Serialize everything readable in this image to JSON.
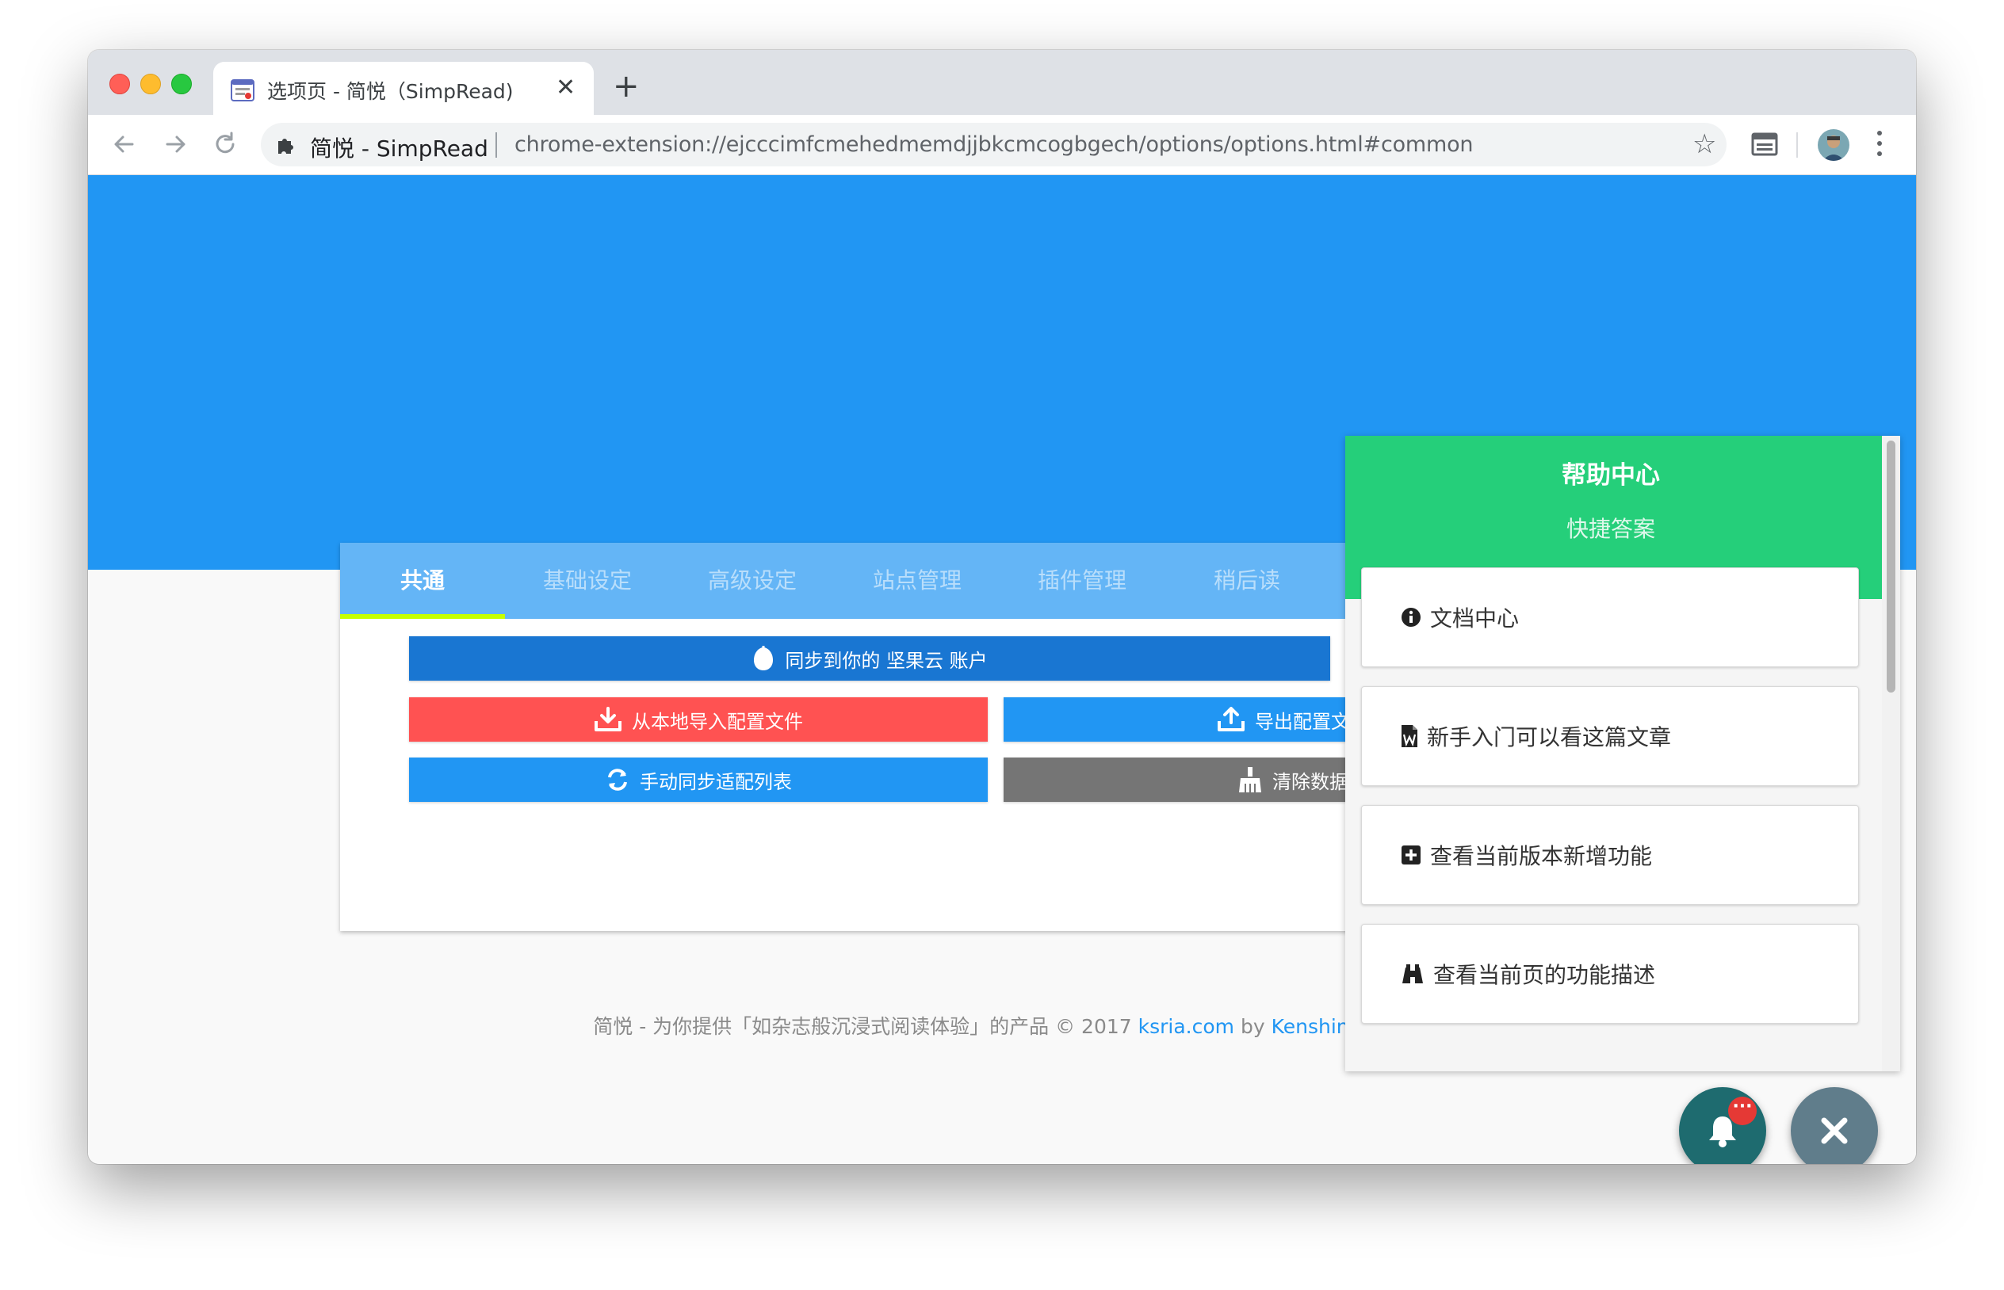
{
  "browser": {
    "tab_title": "选项页 - 简悦（SimpRead)",
    "tab_close": "✕",
    "new_tab": "+",
    "omnibox_site_name": "简悦 - SimpRead",
    "omnibox_url": "chrome-extension://ejcccimfcmehedmemdjjbkcmcogbgech/options/options.html#common",
    "bookmark_star": "☆"
  },
  "tabs": [
    "共通",
    "基础设定",
    "高级设定",
    "站点管理",
    "插件管理",
    "稍后读"
  ],
  "active_tab": "共通",
  "buttons": {
    "sync_jianguoyun": "同步到你的 坚果云 账户",
    "import_local": "从本地导入配置文件",
    "export_config": "导出配置文件",
    "manual_sync": "手动同步适配列表",
    "clear_data": "清除数据"
  },
  "colors": {
    "hero_blue": "#2196f3",
    "tabs_bg": "#64b5f6",
    "tab_indicator": "#c6ff00",
    "sync_button": "#1976d2",
    "import_button": "#ff5252",
    "export_button": "#2196f3",
    "clear_button": "#757575",
    "help_header": "#25cf7a",
    "fab_bell": "#1e6b6f",
    "fab_close": "#607d8b"
  },
  "footer": {
    "prefix": "简悦 - 为你提供「如杂志般沉浸式阅读体验」的产品 © 2017 ",
    "site_link": "ksria.com",
    "by": " by ",
    "author_link": "Kenshin Wang"
  },
  "help": {
    "title": "帮助中心",
    "subtitle": "快捷答案",
    "items": [
      {
        "icon": "info-circle-icon",
        "label": "文档中心"
      },
      {
        "icon": "word-file-icon",
        "label": "新手入门可以看这篇文章"
      },
      {
        "icon": "plus-square-icon",
        "label": "查看当前版本新增功能"
      },
      {
        "icon": "binoculars-icon",
        "label": "查看当前页的功能描述"
      }
    ]
  },
  "notification_badge": "···"
}
